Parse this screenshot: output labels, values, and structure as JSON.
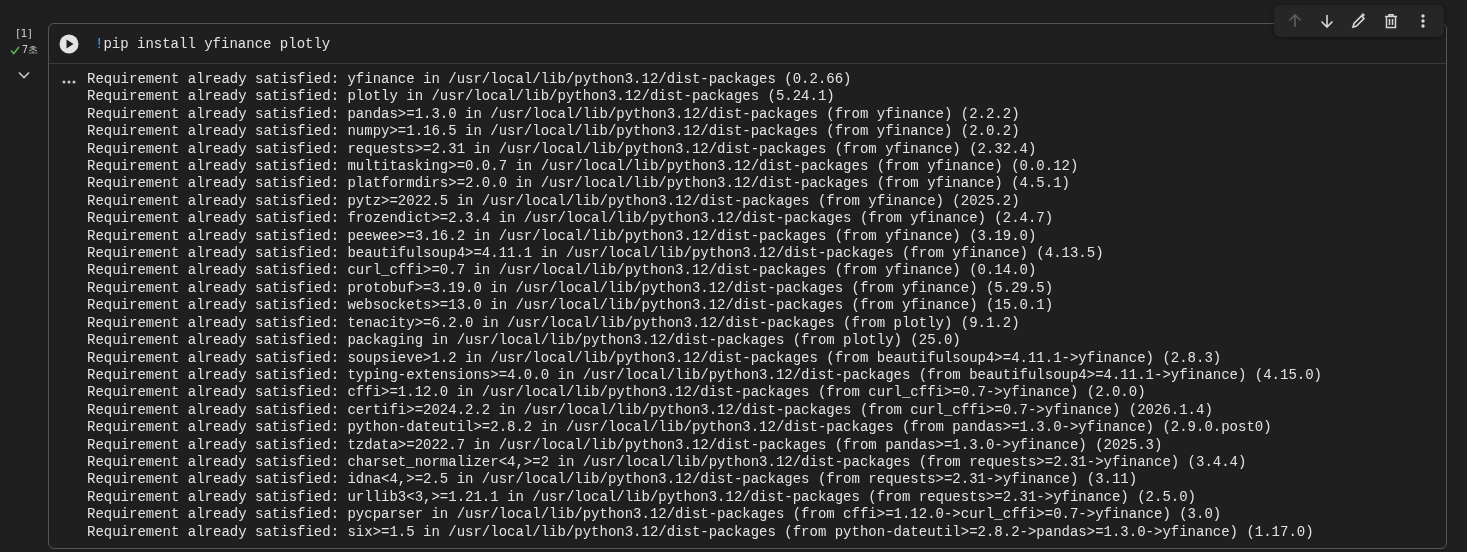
{
  "cell": {
    "execution_count": "[1]",
    "status": {
      "ok": true,
      "duration": "7초"
    },
    "toolbar": [
      {
        "kind": "up",
        "disabled": true
      },
      {
        "kind": "down",
        "disabled": false
      },
      {
        "kind": "edit",
        "disabled": false
      },
      {
        "kind": "delete",
        "disabled": false
      },
      {
        "kind": "more",
        "disabled": false
      }
    ],
    "code": {
      "magic": "!",
      "command": "pip install yfinance plotly"
    },
    "output_expanded": true,
    "output": [
      "Requirement already satisfied: yfinance in /usr/local/lib/python3.12/dist-packages (0.2.66)",
      "Requirement already satisfied: plotly in /usr/local/lib/python3.12/dist-packages (5.24.1)",
      "Requirement already satisfied: pandas>=1.3.0 in /usr/local/lib/python3.12/dist-packages (from yfinance) (2.2.2)",
      "Requirement already satisfied: numpy>=1.16.5 in /usr/local/lib/python3.12/dist-packages (from yfinance) (2.0.2)",
      "Requirement already satisfied: requests>=2.31 in /usr/local/lib/python3.12/dist-packages (from yfinance) (2.32.4)",
      "Requirement already satisfied: multitasking>=0.0.7 in /usr/local/lib/python3.12/dist-packages (from yfinance) (0.0.12)",
      "Requirement already satisfied: platformdirs>=2.0.0 in /usr/local/lib/python3.12/dist-packages (from yfinance) (4.5.1)",
      "Requirement already satisfied: pytz>=2022.5 in /usr/local/lib/python3.12/dist-packages (from yfinance) (2025.2)",
      "Requirement already satisfied: frozendict>=2.3.4 in /usr/local/lib/python3.12/dist-packages (from yfinance) (2.4.7)",
      "Requirement already satisfied: peewee>=3.16.2 in /usr/local/lib/python3.12/dist-packages (from yfinance) (3.19.0)",
      "Requirement already satisfied: beautifulsoup4>=4.11.1 in /usr/local/lib/python3.12/dist-packages (from yfinance) (4.13.5)",
      "Requirement already satisfied: curl_cffi>=0.7 in /usr/local/lib/python3.12/dist-packages (from yfinance) (0.14.0)",
      "Requirement already satisfied: protobuf>=3.19.0 in /usr/local/lib/python3.12/dist-packages (from yfinance) (5.29.5)",
      "Requirement already satisfied: websockets>=13.0 in /usr/local/lib/python3.12/dist-packages (from yfinance) (15.0.1)",
      "Requirement already satisfied: tenacity>=6.2.0 in /usr/local/lib/python3.12/dist-packages (from plotly) (9.1.2)",
      "Requirement already satisfied: packaging in /usr/local/lib/python3.12/dist-packages (from plotly) (25.0)",
      "Requirement already satisfied: soupsieve>1.2 in /usr/local/lib/python3.12/dist-packages (from beautifulsoup4>=4.11.1->yfinance) (2.8.3)",
      "Requirement already satisfied: typing-extensions>=4.0.0 in /usr/local/lib/python3.12/dist-packages (from beautifulsoup4>=4.11.1->yfinance) (4.15.0)",
      "Requirement already satisfied: cffi>=1.12.0 in /usr/local/lib/python3.12/dist-packages (from curl_cffi>=0.7->yfinance) (2.0.0)",
      "Requirement already satisfied: certifi>=2024.2.2 in /usr/local/lib/python3.12/dist-packages (from curl_cffi>=0.7->yfinance) (2026.1.4)",
      "Requirement already satisfied: python-dateutil>=2.8.2 in /usr/local/lib/python3.12/dist-packages (from pandas>=1.3.0->yfinance) (2.9.0.post0)",
      "Requirement already satisfied: tzdata>=2022.7 in /usr/local/lib/python3.12/dist-packages (from pandas>=1.3.0->yfinance) (2025.3)",
      "Requirement already satisfied: charset_normalizer<4,>=2 in /usr/local/lib/python3.12/dist-packages (from requests>=2.31->yfinance) (3.4.4)",
      "Requirement already satisfied: idna<4,>=2.5 in /usr/local/lib/python3.12/dist-packages (from requests>=2.31->yfinance) (3.11)",
      "Requirement already satisfied: urllib3<3,>=1.21.1 in /usr/local/lib/python3.12/dist-packages (from requests>=2.31->yfinance) (2.5.0)",
      "Requirement already satisfied: pycparser in /usr/local/lib/python3.12/dist-packages (from cffi>=1.12.0->curl_cffi>=0.7->yfinance) (3.0)",
      "Requirement already satisfied: six>=1.5 in /usr/local/lib/python3.12/dist-packages (from python-dateutil>=2.8.2->pandas>=1.3.0->yfinance) (1.17.0)"
    ]
  }
}
